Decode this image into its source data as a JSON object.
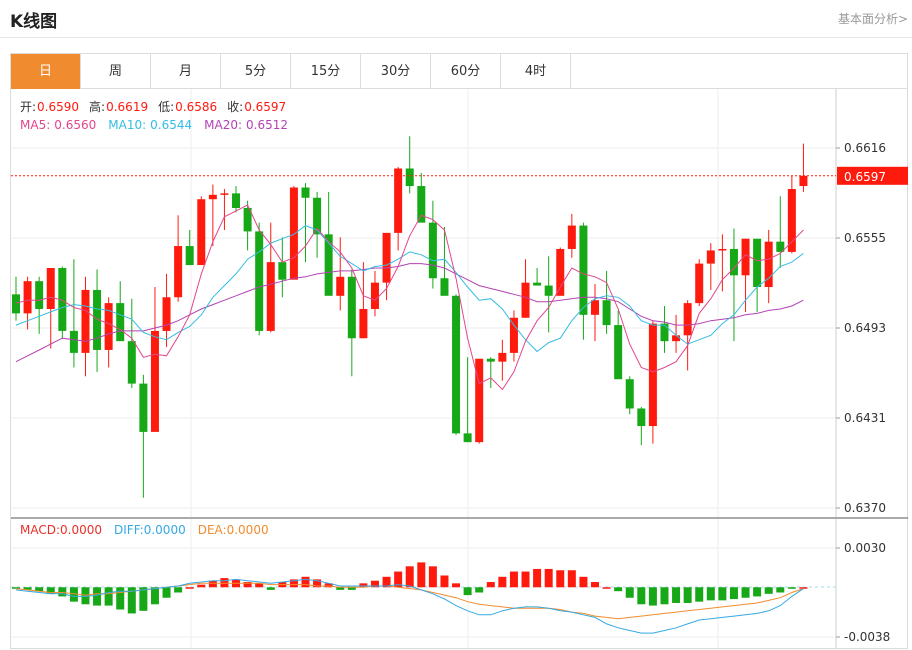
{
  "header": {
    "title": "K线图",
    "more_link": "基本面分析>"
  },
  "tabs": [
    {
      "label": "日",
      "active": true
    },
    {
      "label": "周",
      "active": false
    },
    {
      "label": "月",
      "active": false
    },
    {
      "label": "5分",
      "active": false
    },
    {
      "label": "15分",
      "active": false
    },
    {
      "label": "30分",
      "active": false
    },
    {
      "label": "60分",
      "active": false
    },
    {
      "label": "4时",
      "active": false
    }
  ],
  "ohlc_readout": [
    {
      "label": "开:",
      "value": "0.6590"
    },
    {
      "label": "高:",
      "value": "0.6619"
    },
    {
      "label": "低:",
      "value": "0.6586"
    },
    {
      "label": "收:",
      "value": "0.6597"
    }
  ],
  "ma_readout": [
    {
      "label": "MA5:",
      "value": "0.6560",
      "color": "#e2468d"
    },
    {
      "label": "MA10:",
      "value": "0.6544",
      "color": "#35bde3"
    },
    {
      "label": "MA20:",
      "value": "0.6512",
      "color": "#b442b4"
    }
  ],
  "macd_readout": [
    {
      "label": "MACD:",
      "value": "0.0000",
      "color": "#e8302a"
    },
    {
      "label": "DIFF:",
      "value": "0.0000",
      "color": "#35a9e3"
    },
    {
      "label": "DEA:",
      "value": "0.0000",
      "color": "#f08c2f"
    }
  ],
  "colors": {
    "up": "#ff1a0e",
    "down": "#17a817",
    "ma5": "#e2468d",
    "ma10": "#35bde3",
    "ma20": "#b442b4",
    "diff": "#35a9e3",
    "dea": "#f08c2f",
    "accent": "#f08c2f"
  },
  "chart_data": {
    "type": "candlestick",
    "y_ticks": [
      "0.6616",
      "0.6555",
      "0.6493",
      "0.6431",
      "0.6370"
    ],
    "ylim": [
      0.637,
      0.6616
    ],
    "last_price_label": "0.6597",
    "last_price": 0.6597,
    "candles": [
      [
        0.6516,
        0.6528,
        0.6498,
        0.6503
      ],
      [
        0.6503,
        0.6528,
        0.6492,
        0.6525
      ],
      [
        0.6525,
        0.6528,
        0.6489,
        0.6506
      ],
      [
        0.6506,
        0.6528,
        0.6479,
        0.6534
      ],
      [
        0.6534,
        0.6535,
        0.6486,
        0.6491
      ],
      [
        0.6491,
        0.654,
        0.6466,
        0.6476
      ],
      [
        0.6476,
        0.6528,
        0.646,
        0.6519
      ],
      [
        0.6519,
        0.6533,
        0.6463,
        0.6478
      ],
      [
        0.6478,
        0.6514,
        0.6466,
        0.651
      ],
      [
        0.651,
        0.6525,
        0.6486,
        0.6484
      ],
      [
        0.6484,
        0.6513,
        0.6452,
        0.6455
      ],
      [
        0.6455,
        0.6461,
        0.6377,
        0.6422
      ],
      [
        0.6422,
        0.6521,
        0.6458,
        0.6491
      ],
      [
        0.6491,
        0.653,
        0.648,
        0.6514
      ],
      [
        0.6514,
        0.657,
        0.6511,
        0.6549
      ],
      [
        0.6549,
        0.656,
        0.654,
        0.6536
      ],
      [
        0.6536,
        0.6583,
        0.6538,
        0.6581
      ],
      [
        0.6581,
        0.6591,
        0.6549,
        0.6584
      ],
      [
        0.6584,
        0.6588,
        0.656,
        0.6585
      ],
      [
        0.6585,
        0.659,
        0.6572,
        0.6575
      ],
      [
        0.6575,
        0.658,
        0.6546,
        0.6559
      ],
      [
        0.6559,
        0.6565,
        0.6488,
        0.6491
      ],
      [
        0.6491,
        0.6565,
        0.649,
        0.6538
      ],
      [
        0.6538,
        0.6555,
        0.6514,
        0.6526
      ],
      [
        0.6526,
        0.659,
        0.653,
        0.6589
      ],
      [
        0.6589,
        0.6592,
        0.6538,
        0.6582
      ],
      [
        0.6582,
        0.6586,
        0.6541,
        0.6557
      ],
      [
        0.6557,
        0.6586,
        0.6525,
        0.6515
      ],
      [
        0.6515,
        0.6555,
        0.6505,
        0.6528
      ],
      [
        0.6528,
        0.6533,
        0.646,
        0.6486
      ],
      [
        0.6486,
        0.6538,
        0.6486,
        0.6506
      ],
      [
        0.6506,
        0.6532,
        0.6501,
        0.6524
      ],
      [
        0.6524,
        0.6558,
        0.6512,
        0.6558
      ],
      [
        0.6558,
        0.6603,
        0.6546,
        0.6602
      ],
      [
        0.6602,
        0.6624,
        0.6585,
        0.659
      ],
      [
        0.659,
        0.6599,
        0.6566,
        0.6565
      ],
      [
        0.6565,
        0.658,
        0.652,
        0.6527
      ],
      [
        0.6527,
        0.6562,
        0.652,
        0.6515
      ],
      [
        0.6515,
        0.6516,
        0.642,
        0.6421
      ],
      [
        0.6421,
        0.6473,
        0.6415,
        0.6415
      ],
      [
        0.6415,
        0.6471,
        0.6414,
        0.6472
      ],
      [
        0.6472,
        0.6473,
        0.6452,
        0.647
      ],
      [
        0.647,
        0.6485,
        0.6457,
        0.6476
      ],
      [
        0.6476,
        0.6505,
        0.647,
        0.65
      ],
      [
        0.65,
        0.654,
        0.65,
        0.6524
      ],
      [
        0.6524,
        0.6534,
        0.6522,
        0.6522
      ],
      [
        0.6522,
        0.6542,
        0.649,
        0.6515
      ],
      [
        0.6515,
        0.6548,
        0.6517,
        0.6547
      ],
      [
        0.6547,
        0.6571,
        0.6541,
        0.6563
      ],
      [
        0.6563,
        0.6565,
        0.6485,
        0.6502
      ],
      [
        0.6502,
        0.6523,
        0.6484,
        0.6512
      ],
      [
        0.6512,
        0.6532,
        0.6489,
        0.6495
      ],
      [
        0.6495,
        0.6505,
        0.646,
        0.6458
      ],
      [
        0.6458,
        0.646,
        0.6434,
        0.6438
      ],
      [
        0.6438,
        0.6439,
        0.6413,
        0.6426
      ],
      [
        0.6426,
        0.6498,
        0.6414,
        0.6496
      ],
      [
        0.6496,
        0.6508,
        0.6476,
        0.6484
      ],
      [
        0.6484,
        0.6502,
        0.6476,
        0.6488
      ],
      [
        0.6488,
        0.6512,
        0.6464,
        0.651
      ],
      [
        0.651,
        0.654,
        0.6508,
        0.6537
      ],
      [
        0.6537,
        0.6551,
        0.6519,
        0.6546
      ],
      [
        0.6546,
        0.6557,
        0.6518,
        0.6547
      ],
      [
        0.6547,
        0.6561,
        0.6484,
        0.6529
      ],
      [
        0.6529,
        0.6553,
        0.6504,
        0.6554
      ],
      [
        0.6554,
        0.6552,
        0.6504,
        0.6521
      ],
      [
        0.6521,
        0.656,
        0.651,
        0.6552
      ],
      [
        0.6552,
        0.6583,
        0.6534,
        0.6545
      ],
      [
        0.6545,
        0.6597,
        0.6544,
        0.6588
      ],
      [
        0.659,
        0.6619,
        0.6586,
        0.6597
      ]
    ],
    "ma5": [
      0.651,
      0.6512,
      0.6512,
      0.6514,
      0.6512,
      0.6507,
      0.6505,
      0.6499,
      0.6496,
      0.6492,
      0.6486,
      0.6473,
      0.6475,
      0.6474,
      0.6487,
      0.6502,
      0.653,
      0.6552,
      0.6569,
      0.6573,
      0.6577,
      0.656,
      0.655,
      0.6538,
      0.6541,
      0.6549,
      0.6561,
      0.6552,
      0.6545,
      0.6534,
      0.6515,
      0.6512,
      0.652,
      0.6535,
      0.6556,
      0.657,
      0.6567,
      0.656,
      0.6527,
      0.6486,
      0.6455,
      0.6459,
      0.6451,
      0.6463,
      0.6484,
      0.6498,
      0.6507,
      0.6521,
      0.6534,
      0.653,
      0.6528,
      0.6524,
      0.6506,
      0.6482,
      0.6466,
      0.6463,
      0.6466,
      0.647,
      0.6481,
      0.6503,
      0.6513,
      0.6526,
      0.6534,
      0.6543,
      0.6539,
      0.654,
      0.6544,
      0.6552,
      0.656
    ],
    "ma10": [
      0.6495,
      0.6498,
      0.6501,
      0.6504,
      0.6507,
      0.6509,
      0.6508,
      0.6506,
      0.6505,
      0.6502,
      0.6499,
      0.649,
      0.6487,
      0.6485,
      0.649,
      0.6494,
      0.6502,
      0.6514,
      0.6522,
      0.653,
      0.654,
      0.6545,
      0.6551,
      0.6554,
      0.6557,
      0.6563,
      0.656,
      0.6551,
      0.6542,
      0.6537,
      0.6532,
      0.6535,
      0.6536,
      0.654,
      0.6545,
      0.6543,
      0.6539,
      0.654,
      0.6531,
      0.6521,
      0.6512,
      0.6513,
      0.6506,
      0.6495,
      0.6485,
      0.6477,
      0.6483,
      0.6486,
      0.6498,
      0.6507,
      0.6513,
      0.6515,
      0.6514,
      0.6508,
      0.6498,
      0.6495,
      0.6495,
      0.6488,
      0.6482,
      0.6485,
      0.6488,
      0.6496,
      0.6502,
      0.6512,
      0.6521,
      0.6527,
      0.6535,
      0.6538,
      0.6544
    ],
    "ma20": [
      0.647,
      0.6474,
      0.6478,
      0.6482,
      0.6486,
      0.6485,
      0.6484,
      0.6486,
      0.6489,
      0.6491,
      0.6491,
      0.6491,
      0.6493,
      0.6495,
      0.6498,
      0.6502,
      0.6506,
      0.6509,
      0.6512,
      0.6515,
      0.6518,
      0.6521,
      0.6523,
      0.6525,
      0.6527,
      0.6528,
      0.653,
      0.6531,
      0.6532,
      0.6532,
      0.6533,
      0.6534,
      0.6534,
      0.6535,
      0.6537,
      0.6537,
      0.6536,
      0.6534,
      0.653,
      0.6526,
      0.6522,
      0.652,
      0.6518,
      0.6516,
      0.6514,
      0.6511,
      0.6511,
      0.6512,
      0.6513,
      0.6514,
      0.6514,
      0.6513,
      0.6511,
      0.6506,
      0.6501,
      0.6498,
      0.6497,
      0.6495,
      0.6495,
      0.6496,
      0.6498,
      0.6499,
      0.65,
      0.6502,
      0.6503,
      0.6505,
      0.6506,
      0.6508,
      0.6512
    ],
    "macd_ticks": [
      "0.0030",
      "-0.0038"
    ],
    "macd_ylim": [
      -0.0038,
      0.003
    ],
    "macd_hist": [
      -0.0001,
      -0.0002,
      -0.0003,
      -0.0005,
      -0.0007,
      -0.0011,
      -0.0013,
      -0.0014,
      -0.0014,
      -0.0017,
      -0.002,
      -0.0018,
      -0.0013,
      -0.0008,
      -0.0004,
      0,
      0.0002,
      0.0005,
      0.0007,
      0.0006,
      0.0004,
      0.0003,
      -0.0002,
      0.0004,
      0.0006,
      0.0008,
      0.0006,
      0.0003,
      -0.0002,
      -0.0002,
      0.0003,
      0.0005,
      0.0008,
      0.0012,
      0.0016,
      0.0019,
      0.0016,
      0.0009,
      0.0003,
      -0.0006,
      -0.0004,
      0.0004,
      0.0008,
      0.0012,
      0.0012,
      0.0014,
      0.0014,
      0.0013,
      0.0013,
      0.0008,
      0.0004,
      0,
      -0.0003,
      -0.0008,
      -0.0013,
      -0.0014,
      -0.0013,
      -0.0012,
      -0.0012,
      -0.0011,
      -0.001,
      -0.001,
      -0.0009,
      -0.0008,
      -0.0007,
      -0.0005,
      -0.0004,
      -0.0001,
      0
    ],
    "diff": [
      -0.0002,
      -0.0003,
      -0.0004,
      -0.0005,
      -0.0005,
      -0.0007,
      -0.0007,
      -0.0006,
      -0.0004,
      -0.0003,
      -0.0003,
      -0.0002,
      -0.0001,
      0,
      0.0001,
      0.0003,
      0.0004,
      0.0005,
      0.0005,
      0.0006,
      0.0005,
      0.0004,
      0.0003,
      0.0004,
      0.0005,
      0.0006,
      0.0005,
      0.0003,
      0.0001,
      0.0001,
      0.0001,
      0.0001,
      0.0001,
      0.0002,
      0.0001,
      -0.0002,
      -0.0005,
      -0.0009,
      -0.0014,
      -0.0018,
      -0.0021,
      -0.0021,
      -0.0018,
      -0.0016,
      -0.0015,
      -0.0015,
      -0.0016,
      -0.0018,
      -0.0019,
      -0.0021,
      -0.0023,
      -0.0028,
      -0.0031,
      -0.0033,
      -0.0035,
      -0.0035,
      -0.0033,
      -0.0031,
      -0.0028,
      -0.0025,
      -0.0024,
      -0.0023,
      -0.0022,
      -0.0021,
      -0.002,
      -0.0018,
      -0.0014,
      -0.0007,
      -0.0001
    ],
    "dea": [
      -0.0001,
      -0.0002,
      -0.0003,
      -0.0004,
      -0.0004,
      -0.0005,
      -0.0006,
      -0.0005,
      -0.0005,
      -0.0004,
      -0.0003,
      -0.0002,
      -0.0001,
      0,
      0.0001,
      0.0002,
      0.0003,
      0.0003,
      0.0003,
      0.0003,
      0.0003,
      0.0003,
      0.0002,
      0.0002,
      0.0002,
      0.0002,
      0.0001,
      0.0001,
      0.0,
      0.0,
      0.0,
      0.0001,
      0.0001,
      0.0,
      -0.0001,
      -0.0002,
      -0.0004,
      -0.0006,
      -0.0008,
      -0.0011,
      -0.0013,
      -0.0014,
      -0.0015,
      -0.0016,
      -0.0016,
      -0.0016,
      -0.0016,
      -0.0017,
      -0.0019,
      -0.002,
      -0.0022,
      -0.0023,
      -0.0024,
      -0.0023,
      -0.0022,
      -0.0021,
      -0.002,
      -0.0019,
      -0.0018,
      -0.0017,
      -0.0016,
      -0.0015,
      -0.0014,
      -0.0013,
      -0.0012,
      -0.001,
      -0.0008,
      -0.0004,
      -0.0001
    ]
  }
}
